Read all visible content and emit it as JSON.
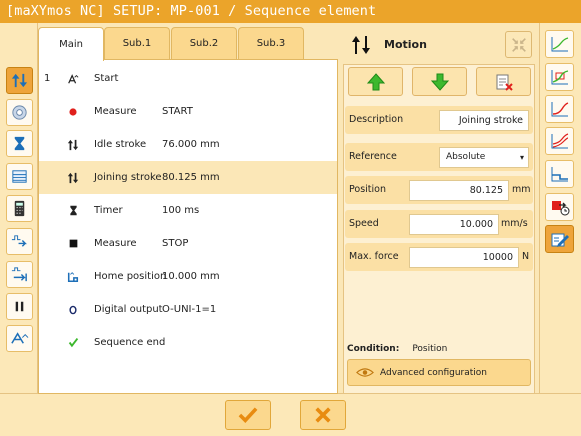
{
  "window": {
    "title": "[maXYmos NC] SETUP: MP-001 / Sequence element"
  },
  "tabs": [
    {
      "label": "Main",
      "active": true
    },
    {
      "label": "Sub.1",
      "active": false
    },
    {
      "label": "Sub.2",
      "active": false
    },
    {
      "label": "Sub.3",
      "active": false
    }
  ],
  "sequence": [
    {
      "num": "1",
      "icon": "start-icon",
      "name": "Start",
      "value": "",
      "selected": false
    },
    {
      "num": "",
      "icon": "red-dot-icon",
      "name": "Measure",
      "value": "START",
      "selected": false
    },
    {
      "num": "",
      "icon": "updown-arrows-icon",
      "name": "Idle stroke",
      "value": "76.000 mm",
      "selected": false
    },
    {
      "num": "",
      "icon": "updown-arrows-icon",
      "name": "Joining stroke",
      "value": "80.125 mm",
      "selected": true
    },
    {
      "num": "",
      "icon": "hourglass-icon",
      "name": "Timer",
      "value": "100 ms",
      "selected": false
    },
    {
      "num": "",
      "icon": "black-square-icon",
      "name": "Measure",
      "value": "STOP",
      "selected": false
    },
    {
      "num": "",
      "icon": "home-icon",
      "name": "Home position",
      "value": "10.000 mm",
      "selected": false
    },
    {
      "num": "",
      "icon": "output-icon",
      "name": "Digital output",
      "value": "O-UNI-1=1",
      "selected": false
    },
    {
      "num": "",
      "icon": "checkmark-icon",
      "name": "Sequence end",
      "value": "",
      "selected": false
    }
  ],
  "motion": {
    "title": "Motion",
    "fields": {
      "description": {
        "label": "Description",
        "value": "Joining stroke"
      },
      "reference": {
        "label": "Reference",
        "value": "Absolute"
      },
      "position": {
        "label": "Position",
        "value": "80.125",
        "unit": "mm"
      },
      "speed": {
        "label": "Speed",
        "value": "10.000",
        "unit": "mm/s"
      },
      "max_force": {
        "label": "Max. force",
        "value": "10000",
        "unit": "N"
      }
    },
    "condition_label": "Condition:",
    "condition_value": "Position",
    "advanced_label": "Advanced configuration"
  },
  "colors": {
    "accent": "#eba42a",
    "highlight": "#fbe7b7",
    "green": "#3db82e",
    "red": "#e0201c"
  }
}
